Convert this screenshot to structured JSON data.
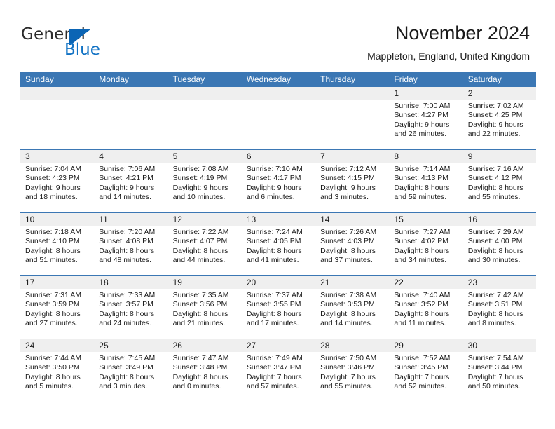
{
  "brand": {
    "name_part1": "General",
    "name_part2": "Blue",
    "flag_icon": "blue-flag-triangle-icon"
  },
  "header": {
    "month_title": "November 2024",
    "location": "Mappleton, England, United Kingdom"
  },
  "colors": {
    "header_blue": "#3b77b4",
    "brand_blue": "#1172c4",
    "num_band_gray": "#efefef",
    "text": "#1a1a1a"
  },
  "calendar": {
    "weekdays": [
      "Sunday",
      "Monday",
      "Tuesday",
      "Wednesday",
      "Thursday",
      "Friday",
      "Saturday"
    ],
    "weeks": [
      [
        {
          "day": "",
          "sunrise": "",
          "sunset": "",
          "daylight": "",
          "daylight2": ""
        },
        {
          "day": "",
          "sunrise": "",
          "sunset": "",
          "daylight": "",
          "daylight2": ""
        },
        {
          "day": "",
          "sunrise": "",
          "sunset": "",
          "daylight": "",
          "daylight2": ""
        },
        {
          "day": "",
          "sunrise": "",
          "sunset": "",
          "daylight": "",
          "daylight2": ""
        },
        {
          "day": "",
          "sunrise": "",
          "sunset": "",
          "daylight": "",
          "daylight2": ""
        },
        {
          "day": "1",
          "sunrise": "Sunrise: 7:00 AM",
          "sunset": "Sunset: 4:27 PM",
          "daylight": "Daylight: 9 hours",
          "daylight2": "and 26 minutes."
        },
        {
          "day": "2",
          "sunrise": "Sunrise: 7:02 AM",
          "sunset": "Sunset: 4:25 PM",
          "daylight": "Daylight: 9 hours",
          "daylight2": "and 22 minutes."
        }
      ],
      [
        {
          "day": "3",
          "sunrise": "Sunrise: 7:04 AM",
          "sunset": "Sunset: 4:23 PM",
          "daylight": "Daylight: 9 hours",
          "daylight2": "and 18 minutes."
        },
        {
          "day": "4",
          "sunrise": "Sunrise: 7:06 AM",
          "sunset": "Sunset: 4:21 PM",
          "daylight": "Daylight: 9 hours",
          "daylight2": "and 14 minutes."
        },
        {
          "day": "5",
          "sunrise": "Sunrise: 7:08 AM",
          "sunset": "Sunset: 4:19 PM",
          "daylight": "Daylight: 9 hours",
          "daylight2": "and 10 minutes."
        },
        {
          "day": "6",
          "sunrise": "Sunrise: 7:10 AM",
          "sunset": "Sunset: 4:17 PM",
          "daylight": "Daylight: 9 hours",
          "daylight2": "and 6 minutes."
        },
        {
          "day": "7",
          "sunrise": "Sunrise: 7:12 AM",
          "sunset": "Sunset: 4:15 PM",
          "daylight": "Daylight: 9 hours",
          "daylight2": "and 3 minutes."
        },
        {
          "day": "8",
          "sunrise": "Sunrise: 7:14 AM",
          "sunset": "Sunset: 4:13 PM",
          "daylight": "Daylight: 8 hours",
          "daylight2": "and 59 minutes."
        },
        {
          "day": "9",
          "sunrise": "Sunrise: 7:16 AM",
          "sunset": "Sunset: 4:12 PM",
          "daylight": "Daylight: 8 hours",
          "daylight2": "and 55 minutes."
        }
      ],
      [
        {
          "day": "10",
          "sunrise": "Sunrise: 7:18 AM",
          "sunset": "Sunset: 4:10 PM",
          "daylight": "Daylight: 8 hours",
          "daylight2": "and 51 minutes."
        },
        {
          "day": "11",
          "sunrise": "Sunrise: 7:20 AM",
          "sunset": "Sunset: 4:08 PM",
          "daylight": "Daylight: 8 hours",
          "daylight2": "and 48 minutes."
        },
        {
          "day": "12",
          "sunrise": "Sunrise: 7:22 AM",
          "sunset": "Sunset: 4:07 PM",
          "daylight": "Daylight: 8 hours",
          "daylight2": "and 44 minutes."
        },
        {
          "day": "13",
          "sunrise": "Sunrise: 7:24 AM",
          "sunset": "Sunset: 4:05 PM",
          "daylight": "Daylight: 8 hours",
          "daylight2": "and 41 minutes."
        },
        {
          "day": "14",
          "sunrise": "Sunrise: 7:26 AM",
          "sunset": "Sunset: 4:03 PM",
          "daylight": "Daylight: 8 hours",
          "daylight2": "and 37 minutes."
        },
        {
          "day": "15",
          "sunrise": "Sunrise: 7:27 AM",
          "sunset": "Sunset: 4:02 PM",
          "daylight": "Daylight: 8 hours",
          "daylight2": "and 34 minutes."
        },
        {
          "day": "16",
          "sunrise": "Sunrise: 7:29 AM",
          "sunset": "Sunset: 4:00 PM",
          "daylight": "Daylight: 8 hours",
          "daylight2": "and 30 minutes."
        }
      ],
      [
        {
          "day": "17",
          "sunrise": "Sunrise: 7:31 AM",
          "sunset": "Sunset: 3:59 PM",
          "daylight": "Daylight: 8 hours",
          "daylight2": "and 27 minutes."
        },
        {
          "day": "18",
          "sunrise": "Sunrise: 7:33 AM",
          "sunset": "Sunset: 3:57 PM",
          "daylight": "Daylight: 8 hours",
          "daylight2": "and 24 minutes."
        },
        {
          "day": "19",
          "sunrise": "Sunrise: 7:35 AM",
          "sunset": "Sunset: 3:56 PM",
          "daylight": "Daylight: 8 hours",
          "daylight2": "and 21 minutes."
        },
        {
          "day": "20",
          "sunrise": "Sunrise: 7:37 AM",
          "sunset": "Sunset: 3:55 PM",
          "daylight": "Daylight: 8 hours",
          "daylight2": "and 17 minutes."
        },
        {
          "day": "21",
          "sunrise": "Sunrise: 7:38 AM",
          "sunset": "Sunset: 3:53 PM",
          "daylight": "Daylight: 8 hours",
          "daylight2": "and 14 minutes."
        },
        {
          "day": "22",
          "sunrise": "Sunrise: 7:40 AM",
          "sunset": "Sunset: 3:52 PM",
          "daylight": "Daylight: 8 hours",
          "daylight2": "and 11 minutes."
        },
        {
          "day": "23",
          "sunrise": "Sunrise: 7:42 AM",
          "sunset": "Sunset: 3:51 PM",
          "daylight": "Daylight: 8 hours",
          "daylight2": "and 8 minutes."
        }
      ],
      [
        {
          "day": "24",
          "sunrise": "Sunrise: 7:44 AM",
          "sunset": "Sunset: 3:50 PM",
          "daylight": "Daylight: 8 hours",
          "daylight2": "and 5 minutes."
        },
        {
          "day": "25",
          "sunrise": "Sunrise: 7:45 AM",
          "sunset": "Sunset: 3:49 PM",
          "daylight": "Daylight: 8 hours",
          "daylight2": "and 3 minutes."
        },
        {
          "day": "26",
          "sunrise": "Sunrise: 7:47 AM",
          "sunset": "Sunset: 3:48 PM",
          "daylight": "Daylight: 8 hours",
          "daylight2": "and 0 minutes."
        },
        {
          "day": "27",
          "sunrise": "Sunrise: 7:49 AM",
          "sunset": "Sunset: 3:47 PM",
          "daylight": "Daylight: 7 hours",
          "daylight2": "and 57 minutes."
        },
        {
          "day": "28",
          "sunrise": "Sunrise: 7:50 AM",
          "sunset": "Sunset: 3:46 PM",
          "daylight": "Daylight: 7 hours",
          "daylight2": "and 55 minutes."
        },
        {
          "day": "29",
          "sunrise": "Sunrise: 7:52 AM",
          "sunset": "Sunset: 3:45 PM",
          "daylight": "Daylight: 7 hours",
          "daylight2": "and 52 minutes."
        },
        {
          "day": "30",
          "sunrise": "Sunrise: 7:54 AM",
          "sunset": "Sunset: 3:44 PM",
          "daylight": "Daylight: 7 hours",
          "daylight2": "and 50 minutes."
        }
      ]
    ]
  }
}
